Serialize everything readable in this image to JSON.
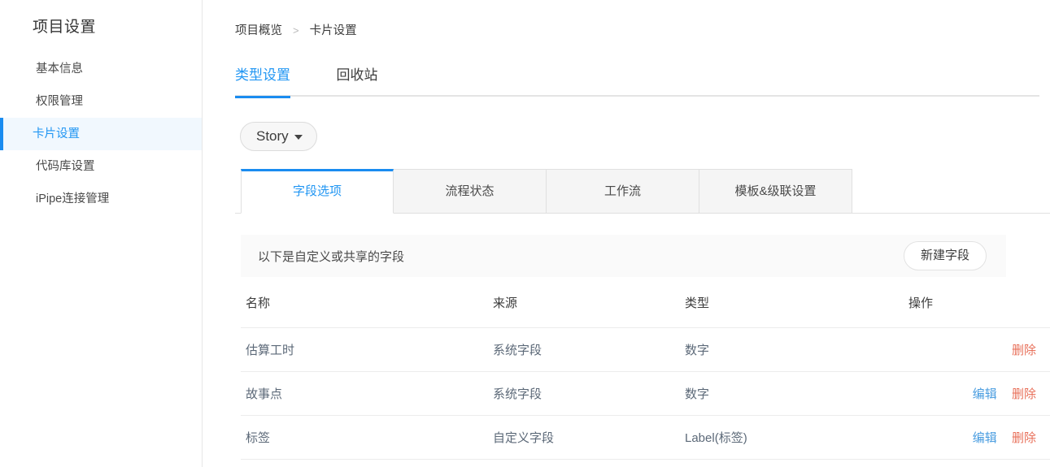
{
  "sidebar": {
    "title": "项目设置",
    "items": [
      {
        "label": "基本信息",
        "active": false
      },
      {
        "label": "权限管理",
        "active": false
      },
      {
        "label": "卡片设置",
        "active": true
      },
      {
        "label": "代码库设置",
        "active": false
      },
      {
        "label": "iPipe连接管理",
        "active": false
      }
    ]
  },
  "breadcrumb": {
    "parent": "项目概览",
    "separator": ">",
    "current": "卡片设置"
  },
  "top_tabs": [
    {
      "label": "类型设置",
      "active": true
    },
    {
      "label": "回收站",
      "active": false
    }
  ],
  "type_selector": {
    "label": "Story",
    "caret": "chevron-down-icon"
  },
  "sub_tabs": [
    {
      "label": "字段选项",
      "active": true
    },
    {
      "label": "流程状态",
      "active": false
    },
    {
      "label": "工作流",
      "active": false
    },
    {
      "label": "模板&级联设置",
      "active": false
    }
  ],
  "info_bar": {
    "text": "以下是自定义或共享的字段",
    "button_label": "新建字段"
  },
  "table": {
    "headers": [
      "名称",
      "来源",
      "类型",
      "操作"
    ],
    "rows": [
      {
        "name": "估算工时",
        "source": "系统字段",
        "type": "数字",
        "edit_label": "",
        "delete_label": "删除"
      },
      {
        "name": "故事点",
        "source": "系统字段",
        "type": "数字",
        "edit_label": "编辑",
        "delete_label": "删除"
      },
      {
        "name": "标签",
        "source": "自定义字段",
        "type": "Label(标签)",
        "edit_label": "编辑",
        "delete_label": "删除"
      }
    ]
  },
  "colors": {
    "accent": "#1a8cf0",
    "link": "#2196f3",
    "edit": "#4a9de0",
    "delete": "#e8705a",
    "active_bg": "#f1f8fe",
    "panel_bg": "#fafafa",
    "tab_bg": "#f5f5f5",
    "border": "#e0e0e0"
  }
}
